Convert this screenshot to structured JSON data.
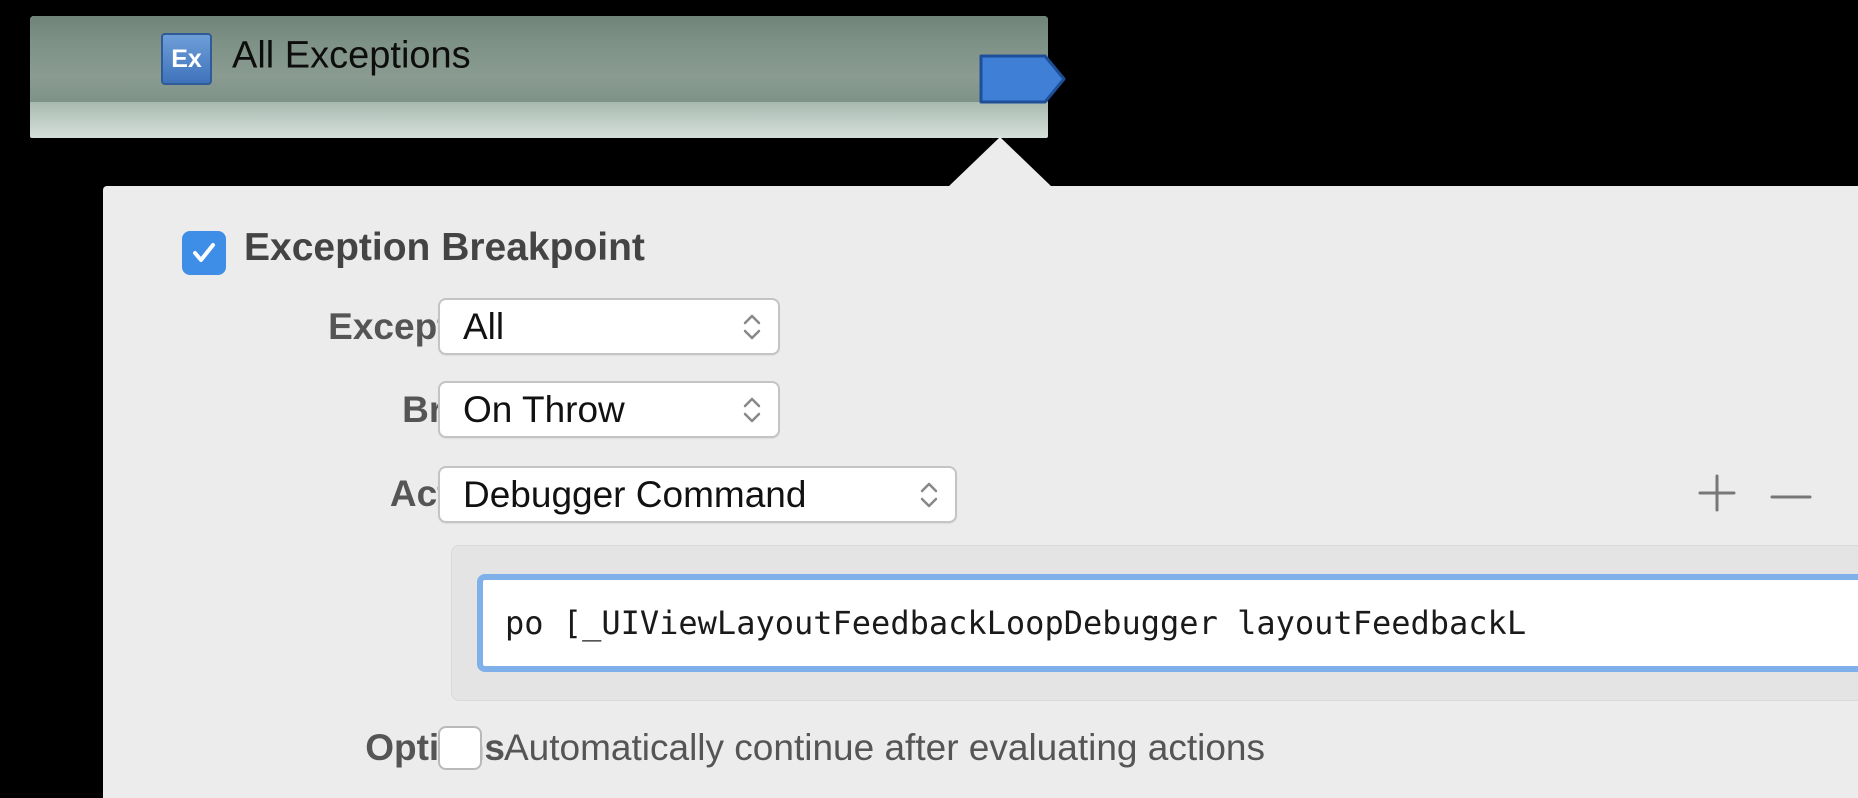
{
  "breakpoint_row": {
    "icon_text": "Ex",
    "title": "All Exceptions",
    "enabled": true,
    "indicator_color": "#3f7fd6"
  },
  "editor": {
    "enabled": true,
    "title": "Exception Breakpoint",
    "exception_label": "Exception",
    "exception_value": "All",
    "break_label": "Break",
    "break_value": "On Throw",
    "action_label": "Action",
    "action_value": "Debugger Command",
    "add_action_icon": "plus-icon",
    "remove_action_icon": "minus-icon",
    "debugger_command": "po [_UIViewLayoutFeedbackLoopDebugger layoutFeedbackL",
    "options_label": "Options",
    "auto_continue_checked": false,
    "auto_continue_label": "Automatically continue after evaluating actions"
  },
  "colors": {
    "accent": "#3e8ee8",
    "focus_ring": "#7fb0ea"
  }
}
